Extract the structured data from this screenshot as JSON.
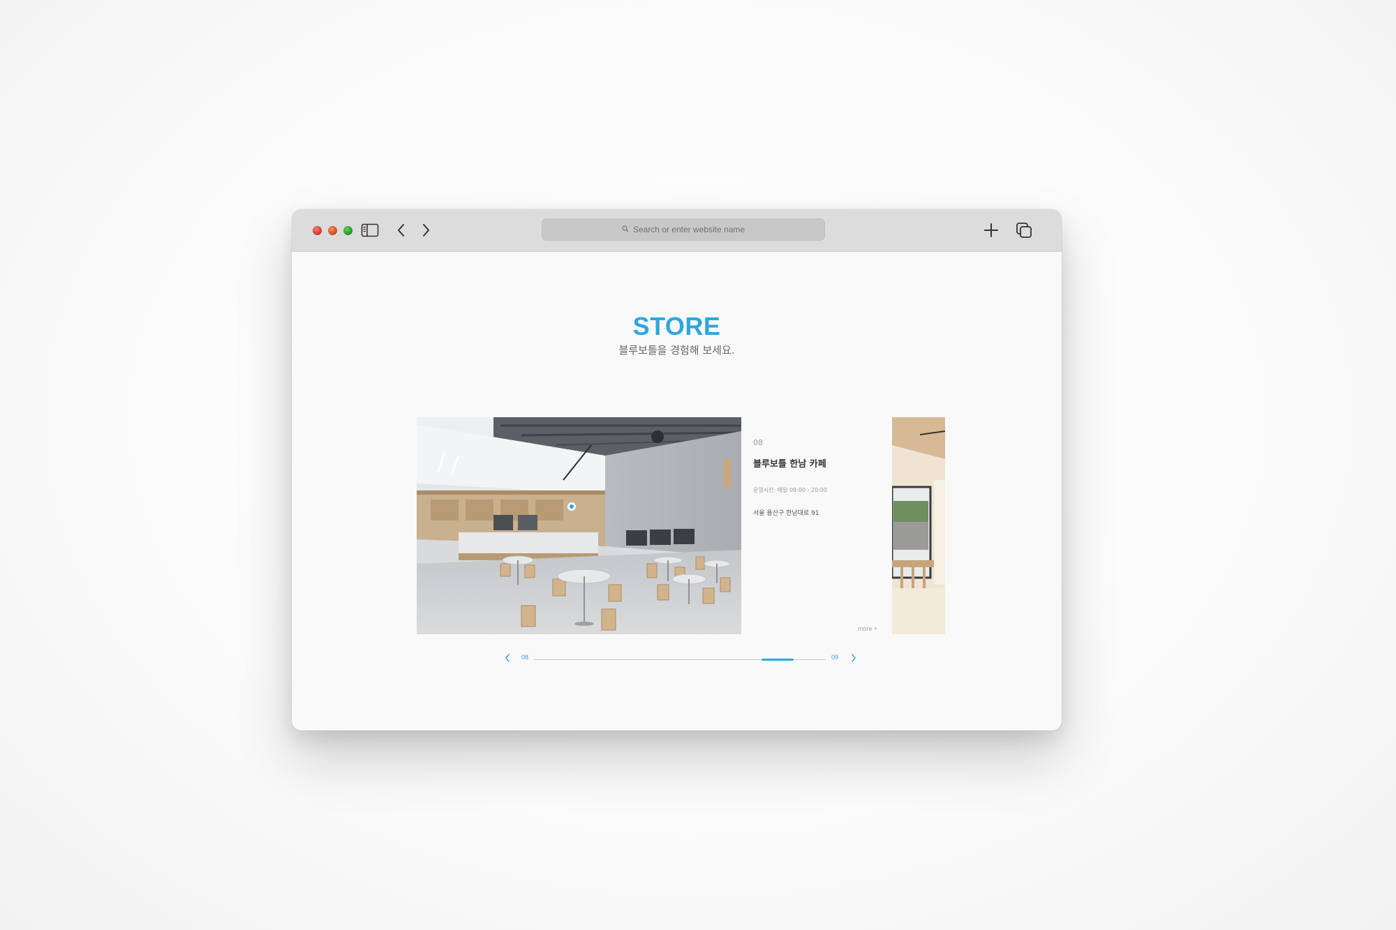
{
  "browser": {
    "address_placeholder": "Search or enter website name",
    "icons": [
      "sidebar-icon",
      "back-chevron-icon",
      "forward-chevron-icon",
      "search-icon",
      "new-tab-plus-icon",
      "tabs-overview-icon"
    ]
  },
  "page": {
    "title": "STORE",
    "subtitle": "블루보틀을 경험해 보세요."
  },
  "store": {
    "number": "08",
    "name": "블루보틀 한남 카페",
    "hours": "운영시간: 매일 09:00 - 20:00",
    "address": "서울 용산구 한남대로 91",
    "more_label": "more +"
  },
  "slider": {
    "current": "08",
    "total": "09",
    "progress_start": 0.78,
    "progress_end": 0.89
  },
  "colors": {
    "accent": "#2ea6de",
    "toolbar": "#dcdcdc",
    "content_bg": "#f9f9f9"
  }
}
